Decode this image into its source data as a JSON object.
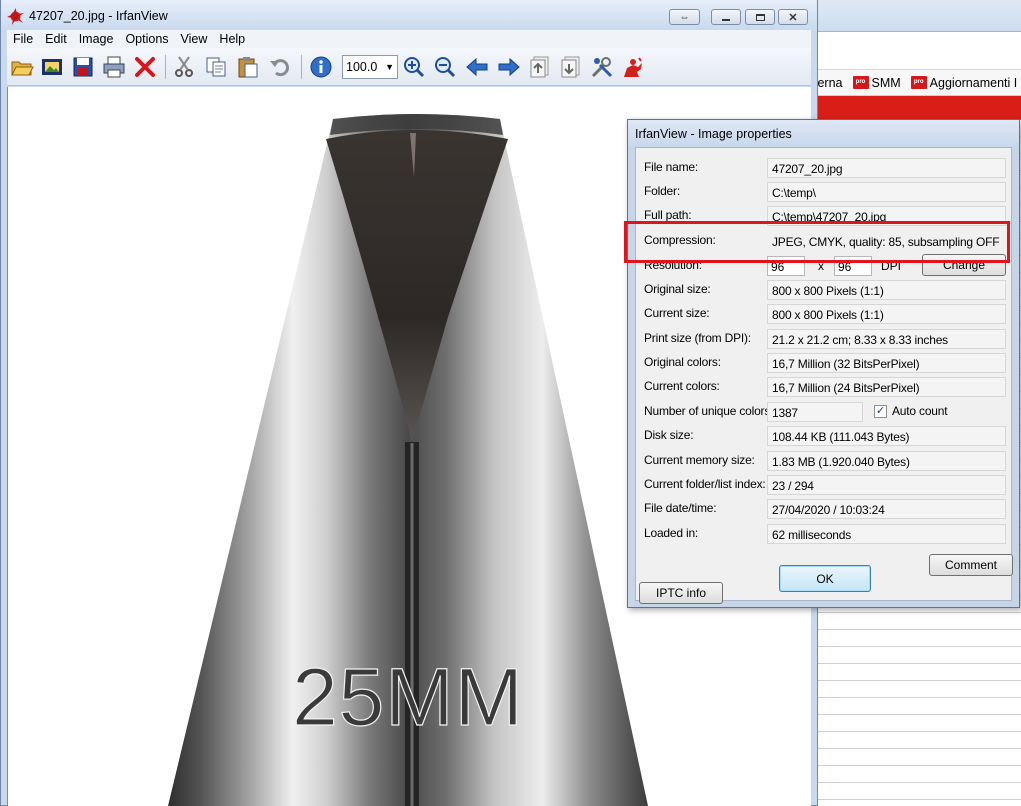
{
  "browser": {
    "bookmarks": [
      {
        "label": "terna",
        "has_icon": false
      },
      {
        "label": "SMM",
        "has_icon": true
      },
      {
        "label": "Aggiornamenti I",
        "has_icon": true
      }
    ],
    "bookmark_icon_text": "pro"
  },
  "irfanview": {
    "title": "47207_20.jpg - IrfanView",
    "menu": [
      "File",
      "Edit",
      "Image",
      "Options",
      "View",
      "Help"
    ],
    "toolbar": {
      "zoom_value": "100.0",
      "icons": [
        "open-folder-icon",
        "slideshow-icon",
        "save-icon",
        "print-icon",
        "delete-icon",
        "cut-icon",
        "copy-icon",
        "paste-icon",
        "undo-icon",
        "info-icon",
        "zoom-in-icon",
        "zoom-out-icon",
        "previous-icon",
        "next-icon",
        "page-up-icon",
        "page-down-icon",
        "settings-icon",
        "irfanview-logo-icon"
      ]
    },
    "image_text": "25MM",
    "colors": {
      "highlight": "#e0141c",
      "toolbar_blue": "#2f6fc7"
    }
  },
  "dialog": {
    "title": "IrfanView - Image properties",
    "rows": [
      {
        "label": "File name:",
        "value": "47207_20.jpg"
      },
      {
        "label": "Folder:",
        "value": "C:\\temp\\"
      },
      {
        "label": "Full path:",
        "value": "C:\\temp\\47207_20.jpg"
      },
      {
        "label": "Compression:",
        "value": "JPEG, CMYK, quality: 85, subsampling OFF"
      }
    ],
    "resolution": {
      "label": "Resolution:",
      "x_value": "96",
      "separator": "x",
      "y_value": "96",
      "unit": "DPI",
      "change_button": "Change"
    },
    "rows2": [
      {
        "label": "Original size:",
        "value": "800 x 800  Pixels (1:1)"
      },
      {
        "label": "Current size:",
        "value": "800 x 800  Pixels (1:1)"
      },
      {
        "label": "Print size (from DPI):",
        "value": "21.2 x 21.2 cm; 8.33 x 8.33 inches"
      },
      {
        "label": "Original colors:",
        "value": "16,7 Million   (32 BitsPerPixel)"
      },
      {
        "label": "Current colors:",
        "value": "16,7 Million   (24 BitsPerPixel)"
      }
    ],
    "unique_colors": {
      "label": "Number of unique colors:",
      "value": "1387",
      "checkbox_label": "Auto count",
      "checkbox_mark": "✓"
    },
    "rows3": [
      {
        "label": "Disk size:",
        "value": "108.44 KB (111.043 Bytes)"
      },
      {
        "label": "Current memory size:",
        "value": "1.83  MB (1.920.040 Bytes)"
      },
      {
        "label": "Current folder/list index:",
        "value": "23  /  294"
      },
      {
        "label": "File date/time:",
        "value": "27/04/2020 / 10:03:24"
      },
      {
        "label": "Loaded in:",
        "value": "62 milliseconds"
      }
    ],
    "buttons": {
      "comment": "Comment",
      "ok": "OK",
      "iptc": "IPTC info"
    }
  }
}
